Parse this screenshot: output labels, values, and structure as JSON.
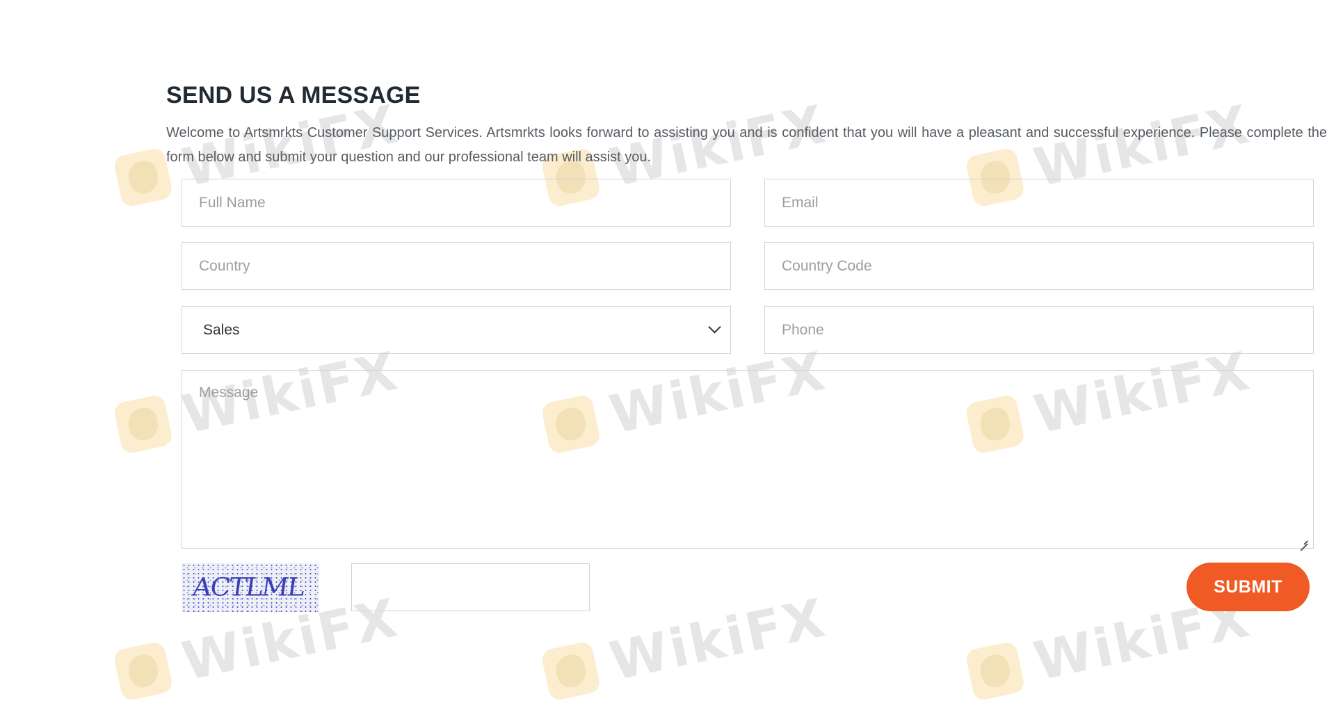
{
  "watermark_text": "WikiFX",
  "form": {
    "heading": "SEND US A MESSAGE",
    "intro": "Welcome to Artsmrkts Customer Support Services. Artsmrkts looks forward to assisting you and is confident that you will have a pleasant and successful experience. Please complete the form below and submit your question and our professional team will assist you.",
    "full_name_placeholder": "Full Name",
    "email_placeholder": "Email",
    "country_placeholder": "Country",
    "country_code_placeholder": "Country Code",
    "department_selected": "Sales",
    "phone_placeholder": "Phone",
    "message_placeholder": "Message",
    "captcha_text": "ACTLML",
    "captcha_input_value": "",
    "submit_label": "SUBMIT"
  },
  "colors": {
    "accent": "#f05a24",
    "heading": "#222a33",
    "text": "#555c63",
    "border": "#d1d4d8"
  }
}
